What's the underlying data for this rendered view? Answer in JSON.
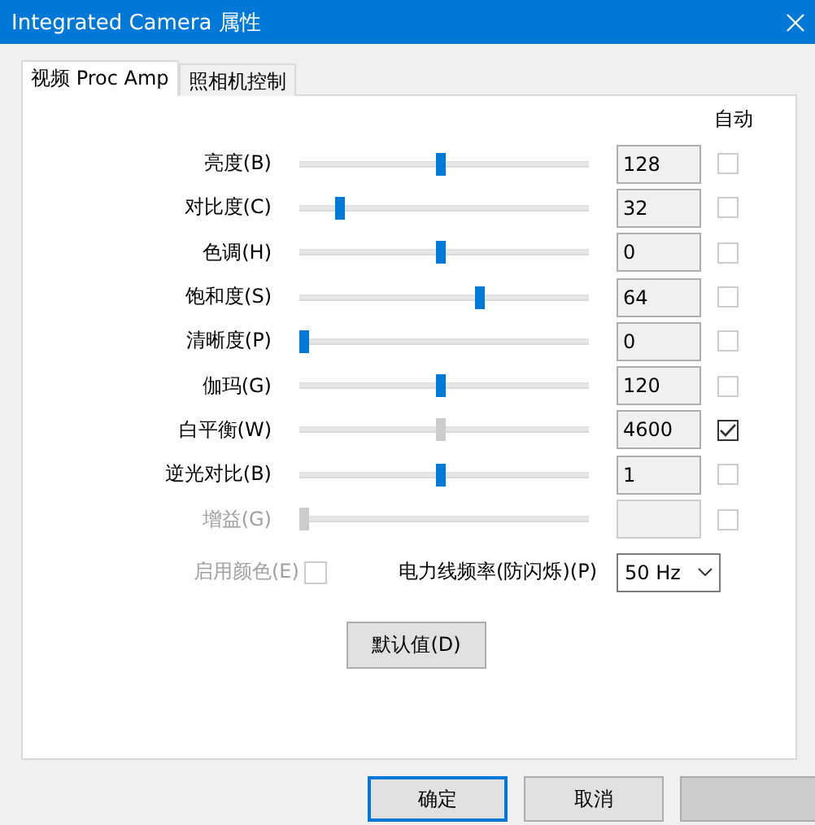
{
  "window": {
    "title": "Integrated Camera 属性"
  },
  "tabs": [
    {
      "label": "视频 Proc Amp",
      "selected": true
    },
    {
      "label": "照相机控制",
      "selected": false
    }
  ],
  "auto_header": "自动",
  "controls": [
    {
      "label": "亮度(B)",
      "level": 0.49,
      "value": "128",
      "auto": false,
      "disabled": false
    },
    {
      "label": "对比度(C)",
      "level": 0.13,
      "value": "32",
      "auto": false,
      "disabled": false
    },
    {
      "label": "色调(H)",
      "level": 0.49,
      "value": "0",
      "auto": false,
      "disabled": false
    },
    {
      "label": "饱和度(S)",
      "level": 0.63,
      "value": "64",
      "auto": false,
      "disabled": false
    },
    {
      "label": "清晰度(P)",
      "level": 0.0,
      "value": "0",
      "auto": false,
      "disabled": false
    },
    {
      "label": "伽玛(G)",
      "level": 0.49,
      "value": "120",
      "auto": false,
      "disabled": false
    },
    {
      "label": "白平衡(W)",
      "level": 0.49,
      "value": "4600",
      "auto": true,
      "disabled": false
    },
    {
      "label": "逆光对比(B)",
      "level": 0.49,
      "value": "1",
      "auto": false,
      "disabled": false
    },
    {
      "label": "增益(G)",
      "level": 0.0,
      "auto": false,
      "disabled": true
    }
  ],
  "color_enable": {
    "label": "启用颜色(E)",
    "checked": false,
    "disabled": true
  },
  "powerline": {
    "label": "电力线频率(防闪烁)(P)",
    "value": "50 Hz"
  },
  "default_button": "默认值(D)",
  "buttons": [
    {
      "label": "确定",
      "kind": "default"
    },
    {
      "label": "取消",
      "kind": "normal"
    },
    {
      "kind": "disabled"
    }
  ]
}
